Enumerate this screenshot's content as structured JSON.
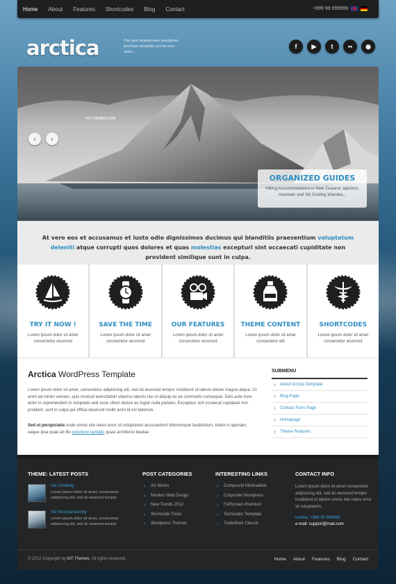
{
  "topnav": {
    "items": [
      {
        "label": "Home",
        "active": true
      },
      {
        "label": "About"
      },
      {
        "label": "Features"
      },
      {
        "label": "Shortcodes"
      },
      {
        "label": "Blog"
      },
      {
        "label": "Contact"
      }
    ],
    "phone": "+999 99 999999",
    "flags": [
      "uk-flag-icon",
      "de-flag-icon"
    ]
  },
  "header": {
    "logo": "arctica",
    "tagline": "The best whitescreen wordpress premium template you've ever seen...",
    "social": [
      {
        "icon": "facebook-icon",
        "glyph": "f"
      },
      {
        "icon": "youtube-icon",
        "glyph": "▶"
      },
      {
        "icon": "twitter-icon",
        "glyph": "t"
      },
      {
        "icon": "flickr-icon",
        "glyph": "••"
      },
      {
        "icon": "rss-icon",
        "glyph": "◉"
      }
    ]
  },
  "slider": {
    "watermark": "AIT-THEMES.COM",
    "caption_title": "ORGANIZED GUIDES",
    "caption_text": "Hiking Accommodations in New Zealand: alpinism, mountain and Ski Guiding Wanaka...",
    "prev": "‹",
    "next": "›"
  },
  "intro": {
    "text_a": "At vero eos et accusamus et iusto odio dignissimos ducimus qui blanditiis praesentium ",
    "hl_a": "voluptatum deleniti",
    "text_b": " atque corrupti quos dolores et quas ",
    "hl_b": "molestias",
    "text_c": " excepturi sint occaecati cupiditate non provident similique sunt in culpa."
  },
  "features": [
    {
      "title": "TRY IT NOW !",
      "desc": "Lorem ipsum dolor sit amet consectetur eiusmod",
      "icon": "windsurf-icon"
    },
    {
      "title": "SAVE THE TIME",
      "desc": "Lorem ipsum dolor sit amet consectetur eiusmod",
      "icon": "watch-icon"
    },
    {
      "title": "OUR FEATURES",
      "desc": "Lorem ipsum dolor sit amet consectetur eiusmod",
      "icon": "camera-icon"
    },
    {
      "title": "THEME CONTENT",
      "desc": "Lorem ipsum dolor sit amet consectetur elit",
      "icon": "bottle-icon"
    },
    {
      "title": "SHORTCODES",
      "desc": "Lorem ipsum dolor sit amet consectetur eiusmod",
      "icon": "caduceus-icon"
    }
  ],
  "main": {
    "title_bold": "Arctica",
    "title_rest": " WordPress Template",
    "para1": "Lorem ipsum dolor sit amet, consectetur adipisicing elit, sed do eiusmod tempor incididunt ut labore dolore magna aliqua. Ut enim ad minim veniam, quis nostrud exercitation ullamco laboris nisi ut aliquip ex ea commodo consequat. Duis aute irure dolor in reprehenderit in voluptate velit esse cillum dolore eu fugiat nulla pariatur. Excepteur sint occaecat cupidatat non proident, sunt in culpa qui officia deserunt mollit anim id est laborum.",
    "para2_bold": "Sed ut perspiciatis",
    "para2_a": " unde omnis iste natus error sit voluptatem accusantium doloremque laudantium, totam in aperiam, eaque ipsa quae ab illo ",
    "para2_link": "inventore veritatis",
    "para2_b": " quasi architecto beatae."
  },
  "submenu": {
    "heading": "SUBMENU",
    "items": [
      "About Arctica Template",
      "Blog Page",
      "Contact Form Page",
      "Homepage",
      "Theme Features"
    ]
  },
  "footer": {
    "latest": {
      "heading": "THEME: LATEST POSTS",
      "posts": [
        {
          "title": "Ice Climbing",
          "desc": "Lorem ipsum dolor sit amet, consectetur adipisicing elit, sed do eiusmod tempor"
        },
        {
          "title": "Ski Mountaineering",
          "desc": "Lorem ipsum dolor sit amet, consectetur adipisicing elit, sed do eiusmod tempor"
        }
      ]
    },
    "categories": {
      "heading": "POST CATEGORIES",
      "items": [
        "Art Works",
        "Modern Web Design",
        "New Trends 2012",
        "Shortcode Tricks",
        "Wordpress Themes"
      ]
    },
    "links": {
      "heading": "INTERESTING LINKS",
      "items": [
        "Compound Minimalistic",
        "Corporate Wordpress",
        "FullScreen Premium",
        "Terminator Template",
        "TradeMark Classic"
      ]
    },
    "contact": {
      "heading": "CONTACT INFO",
      "text": "Lorem ipsum dolor sit amet consectetur adipisicing elit, sed do eiusmod tempor incididunt ut labore omnis iste natus error sit voluptatem.",
      "hotline": "hotline: +999 99 999999",
      "email": "e-mail: support@mail.com"
    },
    "copyright_a": "© 2012 Copyright by ",
    "copyright_b": "AIT-Themes",
    "copyright_c": ". All rights reserved.",
    "nav": [
      "Home",
      "About",
      "Features",
      "Blog",
      "Contact"
    ]
  },
  "colors": {
    "accent": "#2d8dc0",
    "footer_bg": "#232527",
    "topbar_bg": "#1d1f21"
  }
}
